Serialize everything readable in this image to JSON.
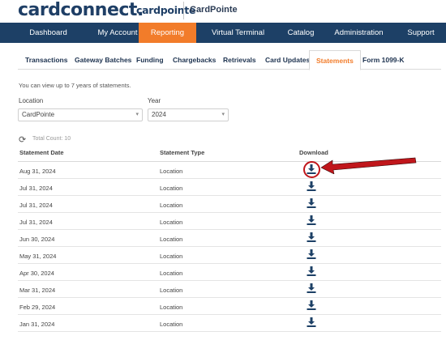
{
  "header": {
    "logo_main": "cardconnect.",
    "logo_sub": "cardpointe",
    "merchant": "CardPointe"
  },
  "mainnav": {
    "items": [
      {
        "label": "Dashboard",
        "active": false
      },
      {
        "label": "My Account",
        "active": false
      },
      {
        "label": "Reporting",
        "active": true
      },
      {
        "label": "Virtual Terminal",
        "active": false
      },
      {
        "label": "Catalog",
        "active": false
      },
      {
        "label": "Administration",
        "active": false
      },
      {
        "label": "Support",
        "active": false
      }
    ]
  },
  "subnav": {
    "tabs": [
      {
        "label": "Transactions",
        "active": false
      },
      {
        "label": "Gateway Batches",
        "active": false
      },
      {
        "label": "Funding",
        "active": false
      },
      {
        "label": "Chargebacks",
        "active": false
      },
      {
        "label": "Retrievals",
        "active": false
      },
      {
        "label": "Card Updates",
        "active": false
      },
      {
        "label": "Statements",
        "active": true
      },
      {
        "label": "Form 1099-K",
        "active": false
      }
    ]
  },
  "note": "You can view up to 7 years of statements.",
  "filters": {
    "location_label": "Location",
    "location_value": "CardPointe",
    "year_label": "Year",
    "year_value": "2024"
  },
  "total_count": "Total Count: 10",
  "table": {
    "headers": [
      "Statement Date",
      "Statement Type",
      "Download"
    ],
    "rows": [
      {
        "date": "Aug 31, 2024",
        "type": "Location"
      },
      {
        "date": "Jul 31, 2024",
        "type": "Location"
      },
      {
        "date": "Jul 31, 2024",
        "type": "Location"
      },
      {
        "date": "Jul 31, 2024",
        "type": "Location"
      },
      {
        "date": "Jun 30, 2024",
        "type": "Location"
      },
      {
        "date": "May 31, 2024",
        "type": "Location"
      },
      {
        "date": "Apr 30, 2024",
        "type": "Location"
      },
      {
        "date": "Mar 31, 2024",
        "type": "Location"
      },
      {
        "date": "Feb 29, 2024",
        "type": "Location"
      },
      {
        "date": "Jan 31, 2024",
        "type": "Location"
      }
    ]
  },
  "colors": {
    "nav_bg": "#1d4066",
    "accent": "#f27c2a",
    "annotation": "#c0161b"
  },
  "icons": {
    "refresh": "refresh-icon",
    "download": "download-icon",
    "dropdown": "chevron-down-icon"
  }
}
